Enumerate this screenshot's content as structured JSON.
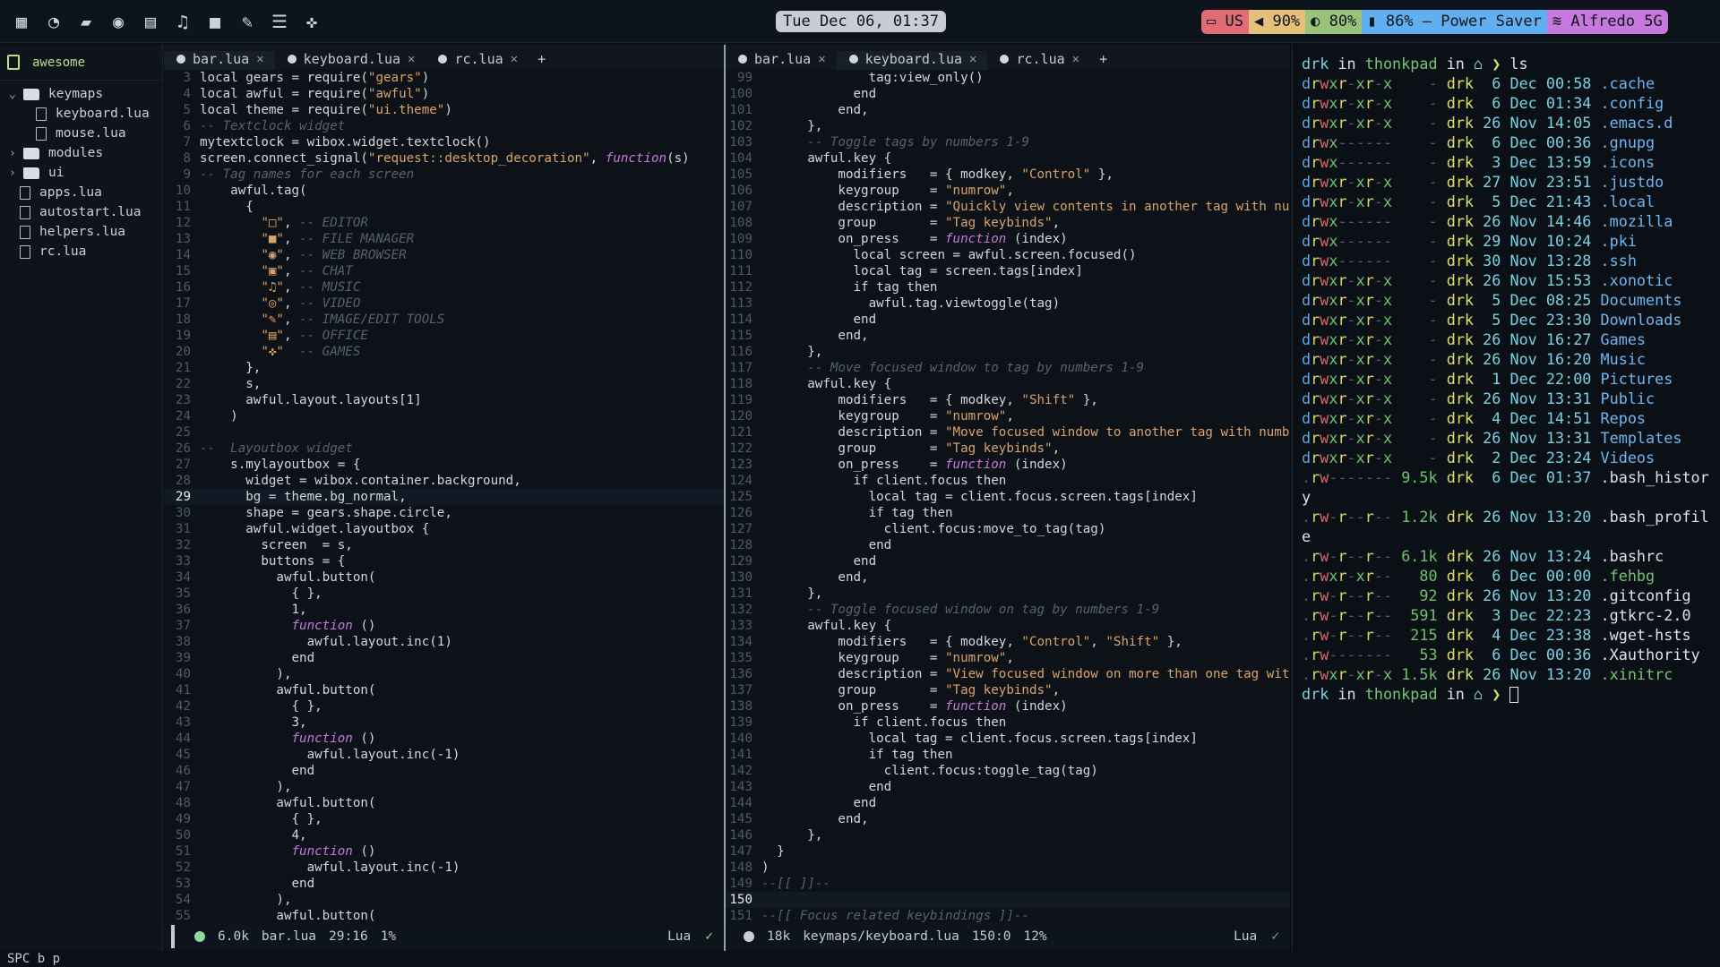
{
  "topbar": {
    "launchers": [
      "apps-grid-icon",
      "firefox-icon",
      "folder-icon",
      "spotify-icon",
      "chat-icon",
      "music-icon",
      "video-icon",
      "pen-icon",
      "notes-icon",
      "games-icon"
    ],
    "clock": "Tue Dec 06, 01:37",
    "status": [
      {
        "label": "US",
        "icon": "keyboard-icon",
        "color": "#e06c75"
      },
      {
        "label": "90%",
        "icon": "volume-icon",
        "color": "#e5c07b"
      },
      {
        "label": "80%",
        "icon": "brightness-icon",
        "color": "#98c379"
      },
      {
        "label": "86% — Power Saver",
        "icon": "battery-icon",
        "color": "#61afef"
      },
      {
        "label": "Alfredo 5G",
        "icon": "wifi-icon",
        "color": "#c678dd"
      }
    ]
  },
  "tree": {
    "root": "awesome",
    "items": [
      {
        "label": "keymaps",
        "type": "folder",
        "depth": 0,
        "open": true
      },
      {
        "label": "keyboard.lua",
        "type": "file",
        "depth": 1
      },
      {
        "label": "mouse.lua",
        "type": "file",
        "depth": 1
      },
      {
        "label": "modules",
        "type": "folder",
        "depth": 0,
        "open": false
      },
      {
        "label": "ui",
        "type": "folder",
        "depth": 0,
        "open": false
      },
      {
        "label": "apps.lua",
        "type": "file",
        "depth": 0
      },
      {
        "label": "autostart.lua",
        "type": "file",
        "depth": 0
      },
      {
        "label": "helpers.lua",
        "type": "file",
        "depth": 0
      },
      {
        "label": "rc.lua",
        "type": "file",
        "depth": 0
      }
    ]
  },
  "editor1": {
    "tabs": [
      "bar.lua",
      "keyboard.lua",
      "rc.lua"
    ],
    "active": 0,
    "status": {
      "size": "6.0k",
      "file": "bar.lua",
      "pos": "29:16",
      "pct": "1%",
      "lang": "Lua",
      "dotColor": "#8fd9a0"
    },
    "current": 29,
    "lines": [
      [
        3,
        "local gears = require(\"gears\")"
      ],
      [
        4,
        "local awful = require(\"awful\")"
      ],
      [
        5,
        "local theme = require(\"ui.theme\")"
      ],
      [
        6,
        "-- Textclock widget"
      ],
      [
        7,
        "mytextclock = wibox.widget.textclock()"
      ],
      [
        8,
        "screen.connect_signal(\"request::desktop_decoration\", function(s)"
      ],
      [
        9,
        "-- Tag names for each screen"
      ],
      [
        10,
        "    awful.tag("
      ],
      [
        11,
        "      {"
      ],
      [
        12,
        "        \"□\", -- EDITOR"
      ],
      [
        13,
        "        \"■\", -- FILE MANAGER"
      ],
      [
        14,
        "        \"◉\", -- WEB BROWSER"
      ],
      [
        15,
        "        \"▣\", -- CHAT"
      ],
      [
        16,
        "        \"♫\", -- MUSIC"
      ],
      [
        17,
        "        \"◎\", -- VIDEO"
      ],
      [
        18,
        "        \"✎\", -- IMAGE/EDIT TOOLS"
      ],
      [
        19,
        "        \"▤\", -- OFFICE"
      ],
      [
        20,
        "        \"✜\"  -- GAMES"
      ],
      [
        21,
        "      },"
      ],
      [
        22,
        "      s,"
      ],
      [
        23,
        "      awful.layout.layouts[1]"
      ],
      [
        24,
        "    )"
      ],
      [
        25,
        ""
      ],
      [
        26,
        "--  Layoutbox widget"
      ],
      [
        27,
        "    s.mylayoutbox = {"
      ],
      [
        28,
        "      widget = wibox.container.background,"
      ],
      [
        29,
        "      bg = theme.bg_normal,"
      ],
      [
        30,
        "      shape = gears.shape.circle,"
      ],
      [
        31,
        "      awful.widget.layoutbox {"
      ],
      [
        32,
        "        screen  = s,"
      ],
      [
        33,
        "        buttons = {"
      ],
      [
        34,
        "          awful.button("
      ],
      [
        35,
        "            { },"
      ],
      [
        36,
        "            1,"
      ],
      [
        37,
        "            function ()"
      ],
      [
        38,
        "              awful.layout.inc(1)"
      ],
      [
        39,
        "            end"
      ],
      [
        40,
        "          ),"
      ],
      [
        41,
        "          awful.button("
      ],
      [
        42,
        "            { },"
      ],
      [
        43,
        "            3,"
      ],
      [
        44,
        "            function ()"
      ],
      [
        45,
        "              awful.layout.inc(-1)"
      ],
      [
        46,
        "            end"
      ],
      [
        47,
        "          ),"
      ],
      [
        48,
        "          awful.button("
      ],
      [
        49,
        "            { },"
      ],
      [
        50,
        "            4,"
      ],
      [
        51,
        "            function ()"
      ],
      [
        52,
        "              awful.layout.inc(-1)"
      ],
      [
        53,
        "            end"
      ],
      [
        54,
        "          ),"
      ],
      [
        55,
        "          awful.button("
      ]
    ]
  },
  "editor2": {
    "tabs": [
      "bar.lua",
      "keyboard.lua",
      "rc.lua"
    ],
    "active": 1,
    "status": {
      "size": "18k",
      "file": "keymaps/keyboard.lua",
      "pos": "150:0",
      "pct": "12%",
      "lang": "Lua",
      "dotColor": "#c8cdd3"
    },
    "current": 150,
    "lines": [
      [
        99,
        "              tag:view_only()"
      ],
      [
        100,
        "            end"
      ],
      [
        101,
        "          end,"
      ],
      [
        102,
        "      },"
      ],
      [
        103,
        "      -- Toggle tags by numbers 1-9"
      ],
      [
        104,
        "      awful.key {"
      ],
      [
        105,
        "          modifiers   = { modkey, \"Control\" },"
      ],
      [
        106,
        "          keygroup    = \"numrow\","
      ],
      [
        107,
        "          description = \"Quickly view contents in another tag with number »"
      ],
      [
        108,
        "          group       = \"Tag keybinds\","
      ],
      [
        109,
        "          on_press    = function (index)"
      ],
      [
        110,
        "            local screen = awful.screen.focused()"
      ],
      [
        111,
        "            local tag = screen.tags[index]"
      ],
      [
        112,
        "            if tag then"
      ],
      [
        113,
        "              awful.tag.viewtoggle(tag)"
      ],
      [
        114,
        "            end"
      ],
      [
        115,
        "          end,"
      ],
      [
        116,
        "      },"
      ],
      [
        117,
        "      -- Move focused window to tag by numbers 1-9"
      ],
      [
        118,
        "      awful.key {"
      ],
      [
        119,
        "          modifiers   = { modkey, \"Shift\" },"
      ],
      [
        120,
        "          keygroup    = \"numrow\","
      ],
      [
        121,
        "          description = \"Move focused window to another tag with number ke»"
      ],
      [
        122,
        "          group       = \"Tag keybinds\","
      ],
      [
        123,
        "          on_press    = function (index)"
      ],
      [
        124,
        "            if client.focus then"
      ],
      [
        125,
        "              local tag = client.focus.screen.tags[index]"
      ],
      [
        126,
        "              if tag then"
      ],
      [
        127,
        "                client.focus:move_to_tag(tag)"
      ],
      [
        128,
        "              end"
      ],
      [
        129,
        "            end"
      ],
      [
        130,
        "          end,"
      ],
      [
        131,
        "      },"
      ],
      [
        132,
        "      -- Toggle focused window on tag by numbers 1-9"
      ],
      [
        133,
        "      awful.key {"
      ],
      [
        134,
        "          modifiers   = { modkey, \"Control\", \"Shift\" },"
      ],
      [
        135,
        "          keygroup    = \"numrow\","
      ],
      [
        136,
        "          description = \"View focused window on more than one tag with num»"
      ],
      [
        137,
        "          group       = \"Tag keybinds\","
      ],
      [
        138,
        "          on_press    = function (index)"
      ],
      [
        139,
        "            if client.focus then"
      ],
      [
        140,
        "              local tag = client.focus.screen.tags[index]"
      ],
      [
        141,
        "              if tag then"
      ],
      [
        142,
        "                client.focus:toggle_tag(tag)"
      ],
      [
        143,
        "              end"
      ],
      [
        144,
        "            end"
      ],
      [
        145,
        "          end,"
      ],
      [
        146,
        "      },"
      ],
      [
        147,
        "  }"
      ],
      [
        148,
        ")"
      ],
      [
        149,
        "--[[ ]]--"
      ],
      [
        150,
        ""
      ],
      [
        151,
        "--[[ Focus related keybindings ]]--"
      ]
    ]
  },
  "terminal": {
    "prompt": {
      "user": "drk",
      "in": "in",
      "host": "thonkpad",
      "cmd": "ls"
    },
    "entries": [
      [
        "drwxr-xr-x",
        "-",
        "drk",
        "6",
        "Dec",
        "00:58",
        ".cache"
      ],
      [
        "drwxr-xr-x",
        "-",
        "drk",
        "6",
        "Dec",
        "01:34",
        ".config"
      ],
      [
        "drwxr-xr-x",
        "-",
        "drk",
        "26",
        "Nov",
        "14:05",
        ".emacs.d"
      ],
      [
        "drwx------",
        "-",
        "drk",
        "6",
        "Dec",
        "00:36",
        ".gnupg"
      ],
      [
        "drwx------",
        "-",
        "drk",
        "3",
        "Dec",
        "13:59",
        ".icons"
      ],
      [
        "drwxr-xr-x",
        "-",
        "drk",
        "27",
        "Nov",
        "23:51",
        ".justdo"
      ],
      [
        "drwxr-xr-x",
        "-",
        "drk",
        "5",
        "Dec",
        "21:43",
        ".local"
      ],
      [
        "drwx------",
        "-",
        "drk",
        "26",
        "Nov",
        "14:46",
        ".mozilla"
      ],
      [
        "drwx------",
        "-",
        "drk",
        "29",
        "Nov",
        "10:24",
        ".pki"
      ],
      [
        "drwx------",
        "-",
        "drk",
        "30",
        "Nov",
        "13:28",
        ".ssh"
      ],
      [
        "drwxr-xr-x",
        "-",
        "drk",
        "26",
        "Nov",
        "15:53",
        ".xonotic"
      ],
      [
        "drwxr-xr-x",
        "-",
        "drk",
        "5",
        "Dec",
        "08:25",
        "Documents"
      ],
      [
        "drwxr-xr-x",
        "-",
        "drk",
        "5",
        "Dec",
        "23:30",
        "Downloads"
      ],
      [
        "drwxr-xr-x",
        "-",
        "drk",
        "26",
        "Nov",
        "16:27",
        "Games"
      ],
      [
        "drwxr-xr-x",
        "-",
        "drk",
        "26",
        "Nov",
        "16:20",
        "Music"
      ],
      [
        "drwxr-xr-x",
        "-",
        "drk",
        "1",
        "Dec",
        "22:00",
        "Pictures"
      ],
      [
        "drwxr-xr-x",
        "-",
        "drk",
        "26",
        "Nov",
        "13:31",
        "Public"
      ],
      [
        "drwxr-xr-x",
        "-",
        "drk",
        "4",
        "Dec",
        "14:51",
        "Repos"
      ],
      [
        "drwxr-xr-x",
        "-",
        "drk",
        "26",
        "Nov",
        "13:31",
        "Templates"
      ],
      [
        "drwxr-xr-x",
        "-",
        "drk",
        "2",
        "Dec",
        "23:24",
        "Videos"
      ],
      [
        ".rw-------",
        "9.5k",
        "drk",
        "6",
        "Dec",
        "01:37",
        ".bash_histor",
        "y"
      ],
      [
        ".rw-r--r--",
        "1.2k",
        "drk",
        "26",
        "Nov",
        "13:20",
        ".bash_profil",
        "e"
      ],
      [
        ".rw-r--r--",
        "6.1k",
        "drk",
        "26",
        "Nov",
        "13:24",
        ".bashrc"
      ],
      [
        ".rwxr-xr--",
        "80",
        "drk",
        "6",
        "Dec",
        "00:00",
        ".fehbg"
      ],
      [
        ".rw-r--r--",
        "92",
        "drk",
        "26",
        "Nov",
        "13:20",
        ".gitconfig"
      ],
      [
        ".rw-r--r--",
        "591",
        "drk",
        "3",
        "Dec",
        "22:23",
        ".gtkrc-2.0"
      ],
      [
        ".rw-r--r--",
        "215",
        "drk",
        "4",
        "Dec",
        "23:38",
        ".wget-hsts"
      ],
      [
        ".rw-------",
        "53",
        "drk",
        "6",
        "Dec",
        "00:36",
        ".Xauthority"
      ],
      [
        ".rwxr-xr-x",
        "1.5k",
        "drk",
        "26",
        "Nov",
        "13:20",
        ".xinitrc"
      ]
    ]
  },
  "minibuffer": "SPC b p"
}
